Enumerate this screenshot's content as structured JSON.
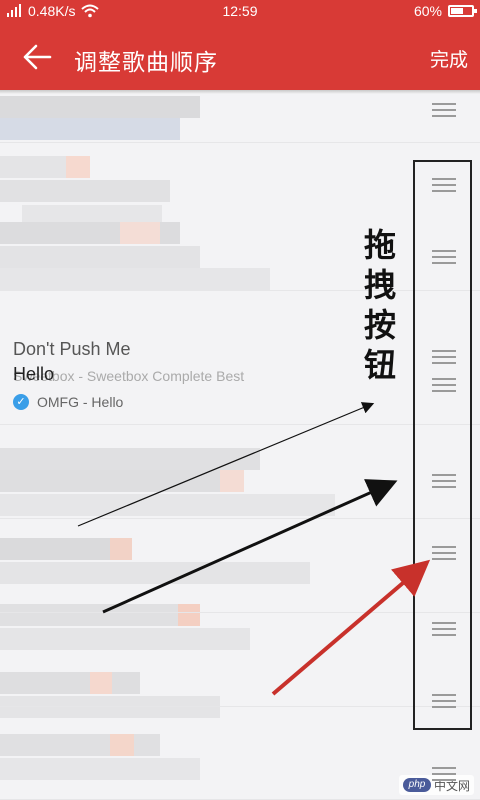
{
  "status_bar": {
    "network": "0.48K/s",
    "time": "12:59",
    "battery": "60%",
    "battery_level": 0.6,
    "signal_icon": "signal-bars-icon",
    "wifi_icon": "wifi-icon",
    "battery_icon": "battery-icon"
  },
  "header": {
    "back_icon": "arrow-left-icon",
    "title": "调整歌曲顺序",
    "done_label": "完成"
  },
  "song": {
    "title": "Don't Push Me",
    "subtitle": "Sweetbox - Sweetbox Complete Best",
    "overlay": "Hello",
    "album_line": "OMFG - Hello",
    "check_icon": "check-circle-icon"
  },
  "annotation": {
    "text": "拖拽按钮"
  },
  "watermark": {
    "logo": "php",
    "site": "中文网"
  },
  "colors": {
    "brand_red": "#d83a36",
    "check_blue": "#3a9ee8",
    "annotation_arrow_red": "#c8312b"
  }
}
